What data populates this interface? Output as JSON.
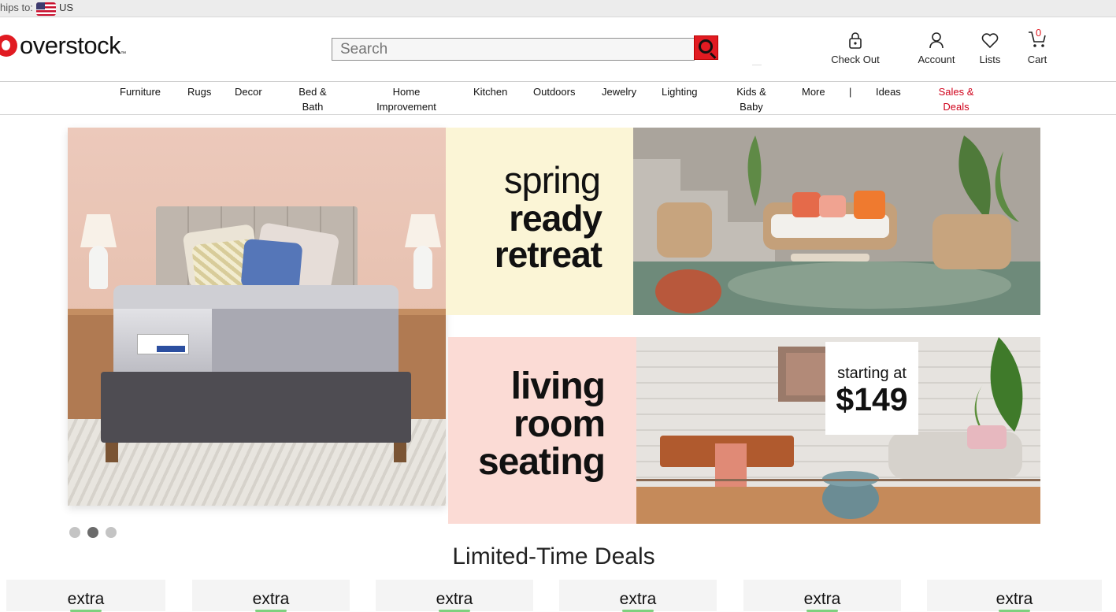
{
  "ships": {
    "label": "hips to:",
    "country": "US"
  },
  "header": {
    "logo_text": "overstock",
    "logo_tm": "™",
    "search_placeholder": "Search",
    "checkout_label": "Check Out",
    "account_label": "Account",
    "lists_label": "Lists",
    "cart_label": "Cart",
    "cart_count": "0"
  },
  "nav": {
    "furniture": "Furniture",
    "rugs": "Rugs",
    "decor": "Decor",
    "bed_bath_1": "Bed &",
    "bed_bath_2": "Bath",
    "home_imp_1": "Home",
    "home_imp_2": "Improvement",
    "kitchen": "Kitchen",
    "outdoors": "Outdoors",
    "jewelry": "Jewelry",
    "lighting": "Lighting",
    "kids_1": "Kids &",
    "kids_2": "Baby",
    "more": "More",
    "divider": "|",
    "ideas": "Ideas",
    "sales_1": "Sales &",
    "sales_2": "Deals"
  },
  "banners": {
    "spring": {
      "l1": "spring",
      "l2": "ready",
      "l3": "retreat"
    },
    "living": {
      "l1": "living",
      "l2": "room",
      "l3": "seating",
      "starting": "starting at",
      "price": "$149"
    }
  },
  "carousel": {
    "active_index": 1,
    "count": 3
  },
  "deals": {
    "title": "Limited-Time Deals",
    "cards": [
      "extra",
      "extra",
      "extra",
      "extra",
      "extra",
      "extra"
    ]
  },
  "colors": {
    "brand": "#e11b22",
    "sale": "#d0021b"
  }
}
